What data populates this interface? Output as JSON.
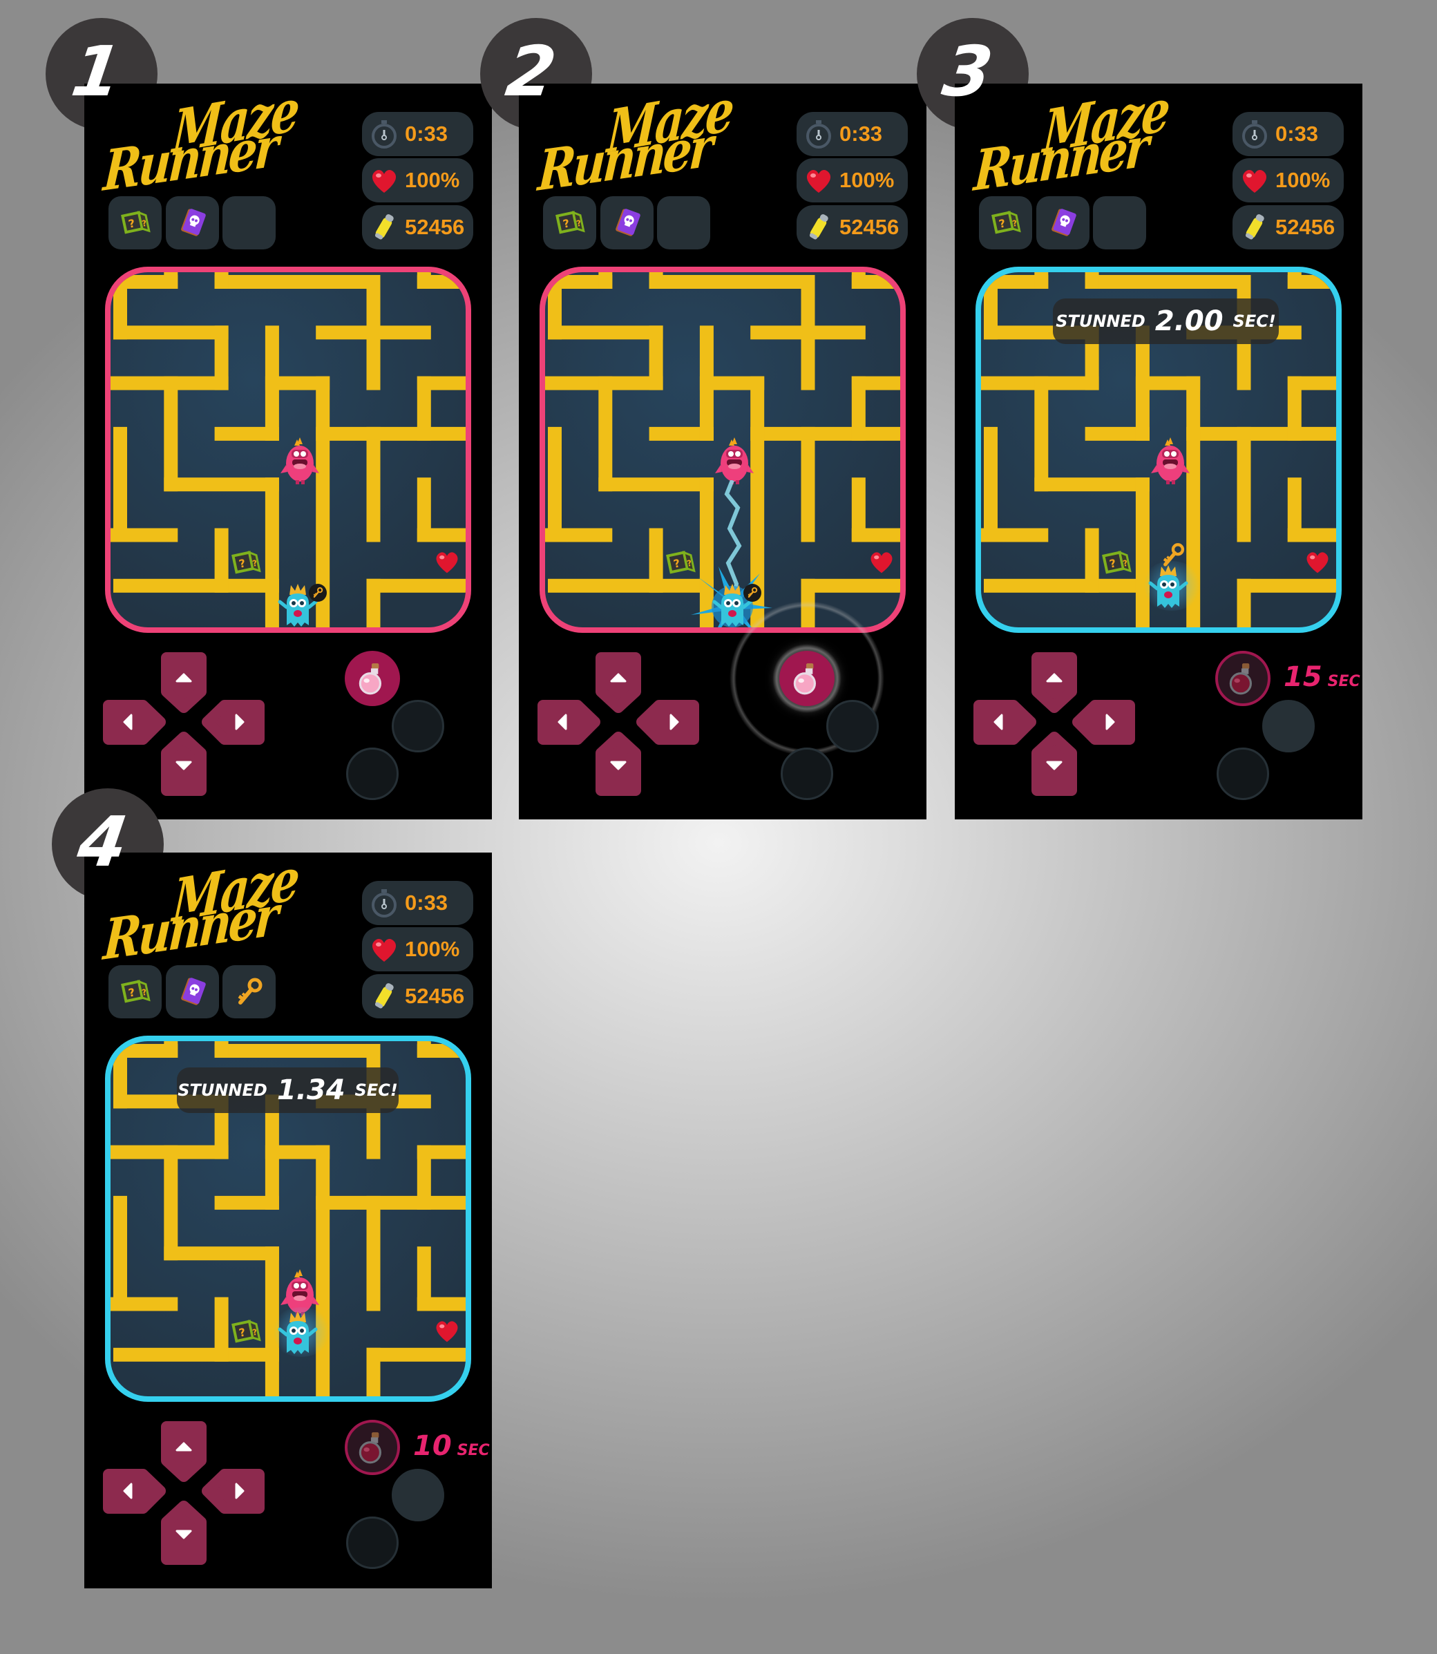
{
  "colors": {
    "maze_wall": "#f0bf18",
    "maze_bg": "#243a4e",
    "border_normal": "#ee4277",
    "border_stunned": "#35d0ee",
    "button": "#8d2a4e",
    "stat_text": "#f59b1a",
    "cooldown_text": "#e8246f",
    "pill_bg": "#263036"
  },
  "logo": {
    "line1": "Maze",
    "line2": "Runner"
  },
  "panels": [
    {
      "number": "1",
      "timer": "0:33",
      "health": "100%",
      "score": "52456",
      "items": [
        "mystery-dice",
        "skull-book",
        ""
      ],
      "border": "normal",
      "potion": "ready",
      "banner": null,
      "cooldown": null,
      "key_state": "badge"
    },
    {
      "number": "2",
      "timer": "0:33",
      "health": "100%",
      "score": "52456",
      "items": [
        "mystery-dice",
        "skull-book",
        ""
      ],
      "border": "normal",
      "potion": "pressed",
      "banner": null,
      "cooldown": null,
      "key_state": "badge",
      "effect": "lightning-stun"
    },
    {
      "number": "3",
      "timer": "0:33",
      "health": "100%",
      "score": "52456",
      "items": [
        "mystery-dice",
        "skull-book",
        ""
      ],
      "border": "stunned",
      "potion": "cooldown",
      "banner": {
        "label": "STUNNED",
        "value": "2.00",
        "unit": "SEC!"
      },
      "cooldown": {
        "value": "15",
        "unit": "SEC"
      },
      "key_state": "floating"
    },
    {
      "number": "4",
      "timer": "0:33",
      "health": "100%",
      "score": "52456",
      "items": [
        "mystery-dice",
        "skull-book",
        "key"
      ],
      "border": "stunned",
      "potion": "cooldown",
      "banner": {
        "label": "STUNNED",
        "value": "1.34",
        "unit": "SEC!"
      },
      "cooldown": {
        "value": "10",
        "unit": "SEC"
      },
      "key_state": "collected"
    }
  ]
}
